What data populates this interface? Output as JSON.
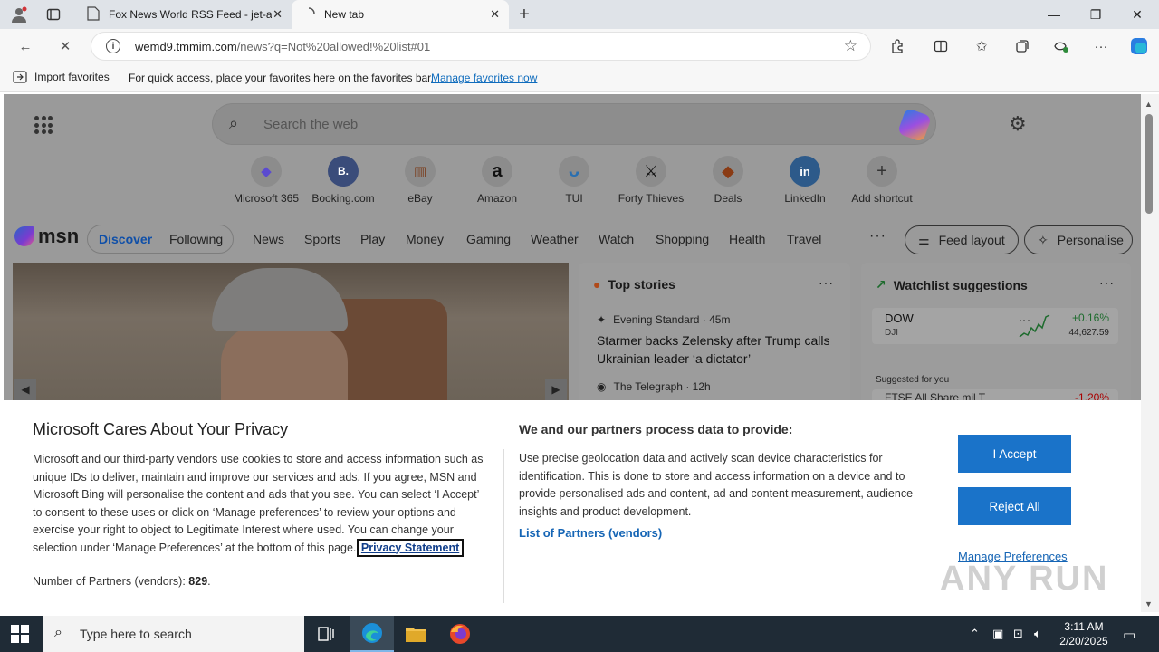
{
  "browser": {
    "tabs": [
      {
        "title": "Fox News World RSS Feed - jet-a",
        "close": "✕"
      },
      {
        "title": "New tab",
        "close": "✕"
      }
    ],
    "new_tab": "+",
    "window": {
      "minimize": "—",
      "restore": "❐",
      "close": "✕"
    },
    "url_host": "wemd9.tmmim.com",
    "url_rest": "/news?q=Not%20allowed!%20list#01",
    "favorites": {
      "import_label": "Import favorites",
      "message": "For quick access, place your favorites here on the favorites bar.",
      "manage_link": "Manage favorites now"
    }
  },
  "msn_page": {
    "search_placeholder": "Search the web",
    "shortcuts": [
      {
        "label": "Microsoft 365",
        "glyph": "◆",
        "color": "#5b4bd0"
      },
      {
        "label": "Booking.com",
        "glyph": "B.",
        "color": "#1d3b7a"
      },
      {
        "label": "eBay",
        "glyph": "▥",
        "color": "#c63"
      },
      {
        "label": "Amazon",
        "glyph": "a",
        "color": "#111"
      },
      {
        "label": "TUI",
        "glyph": "ᴗ",
        "color": "#2a8ad6"
      },
      {
        "label": "Forty Thieves",
        "glyph": "⚔",
        "color": "#111"
      },
      {
        "label": "Deals",
        "glyph": "◆",
        "color": "#c55a1a"
      },
      {
        "label": "LinkedIn",
        "glyph": "in",
        "color": "#1a5fa8"
      },
      {
        "label": "Add shortcut",
        "glyph": "+",
        "color": "#333"
      }
    ],
    "logo_text": "msn",
    "feed_tabs": {
      "discover": "Discover",
      "following": "Following"
    },
    "nav": [
      "News",
      "Sports",
      "Play",
      "Money",
      "Gaming",
      "Weather",
      "Watch",
      "Shopping",
      "Health",
      "Travel"
    ],
    "more": "···",
    "feed_layout": "Feed layout",
    "personalise": "Personalise",
    "top_stories": {
      "title": "Top stories",
      "more": "···",
      "stories": [
        {
          "source": "Evening Standard · 45m",
          "headline": "Starmer backs Zelensky after Trump calls Ukrainian leader ‘a dictator’"
        },
        {
          "source": "The Telegraph · 12h",
          "headline": ""
        }
      ]
    },
    "watchlist": {
      "title": "Watchlist suggestions",
      "more": "···",
      "stock": {
        "name": "DOW",
        "symbol": "DJI",
        "change": "+0.16%",
        "price": "44,627.59"
      },
      "suggested_label": "Suggested for you",
      "stock2": {
        "name": "FTSE All Share mil T",
        "change": "-1.20%"
      }
    }
  },
  "privacy": {
    "title": "Microsoft Cares About Your Privacy",
    "body": "Microsoft and our third-party vendors use cookies to store and access information such as unique IDs to deliver, maintain and improve our services and ads. If you agree, MSN and Microsoft Bing will personalise the content and ads that you see. You can select ‘I Accept’ to consent to these uses or click on ‘Manage preferences’ to review your options and exercise your right to object to Legitimate Interest where used.  You can change your selection under ‘Manage Preferences’ at the bottom of this page. ",
    "privacy_statement": "Privacy Statement",
    "partners_label": "Number of Partners (vendors): ",
    "partners_count": "829",
    "partners_end": ".",
    "purposes_title": "We and our partners process data to provide:",
    "purposes_body": "Use precise geolocation data and actively scan device characteristics for identification. This is done to store and access information on a device and to provide personalised ads and content, ad and content measurement, audience insights and product development.",
    "vendors_link": "List of Partners (vendors)",
    "accept": "I Accept",
    "reject": "Reject All",
    "manage": "Manage Preferences"
  },
  "watermark": "ANY RUN",
  "taskbar": {
    "search_placeholder": "Type here to search",
    "time": "3:11 AM",
    "date": "2/20/2025"
  }
}
